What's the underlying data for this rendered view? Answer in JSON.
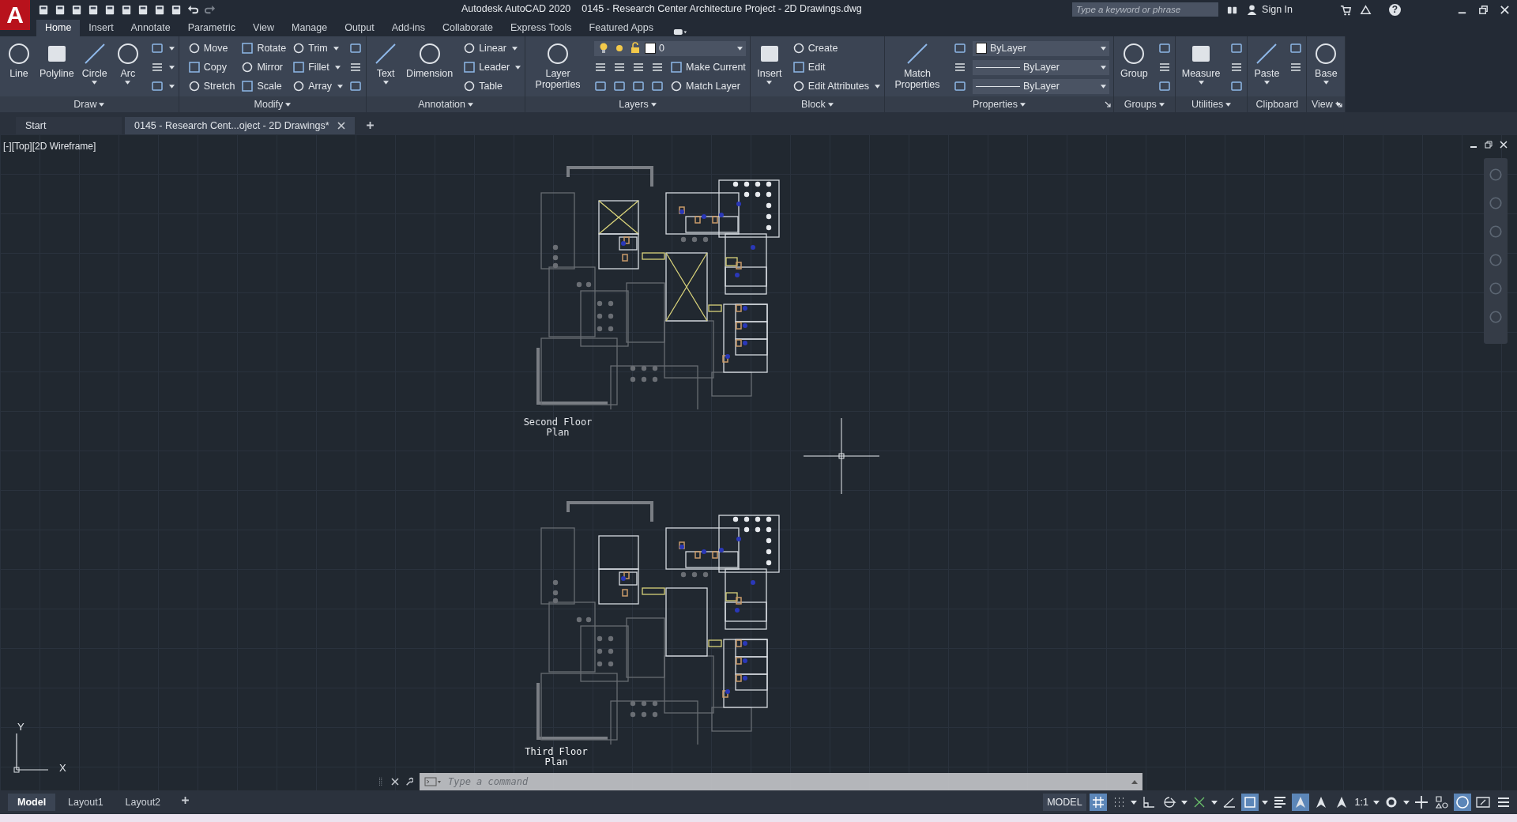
{
  "title_bar": {
    "logo": "A",
    "app": "Autodesk AutoCAD 2020",
    "document": "0145 - Research Center  Architecture Project - 2D Drawings.dwg",
    "search": {
      "placeholder": "Type a keyword or phrase"
    },
    "sign_in": "Sign In",
    "help": "?"
  },
  "ribbon_tabs": [
    {
      "label": "Home",
      "selected": true
    },
    {
      "label": "Insert",
      "selected": false
    },
    {
      "label": "Annotate",
      "selected": false
    },
    {
      "label": "Parametric",
      "selected": false
    },
    {
      "label": "View",
      "selected": false
    },
    {
      "label": "Manage",
      "selected": false
    },
    {
      "label": "Output",
      "selected": false
    },
    {
      "label": "Add-ins",
      "selected": false
    },
    {
      "label": "Collaborate",
      "selected": false
    },
    {
      "label": "Express Tools",
      "selected": false
    },
    {
      "label": "Featured Apps",
      "selected": false
    }
  ],
  "ribbon_panels": [
    {
      "title": "Draw",
      "title_dropdown": true,
      "launcher": false,
      "tools": [
        {
          "label": "Line",
          "dropdown": false
        },
        {
          "label": "Polyline",
          "dropdown": false
        },
        {
          "label": "Circle",
          "dropdown": true
        },
        {
          "label": "Arc",
          "dropdown": true
        }
      ],
      "rows": [
        [
          {
            "kind": "icon",
            "dropdown": true
          }
        ],
        [
          {
            "kind": "icon",
            "dropdown": true
          }
        ],
        [
          {
            "kind": "icon",
            "dropdown": true
          }
        ]
      ]
    },
    {
      "title": "Modify",
      "title_dropdown": true,
      "launcher": false,
      "rows": [
        [
          {
            "kind": "small",
            "label": "Move",
            "dropdown": false
          },
          {
            "kind": "small",
            "label": "Rotate",
            "dropdown": false
          },
          {
            "kind": "small",
            "label": "Trim",
            "dropdown": true
          },
          {
            "kind": "icon",
            "dropdown": false
          }
        ],
        [
          {
            "kind": "small",
            "label": "Copy",
            "dropdown": false
          },
          {
            "kind": "small",
            "label": "Mirror",
            "dropdown": false
          },
          {
            "kind": "small",
            "label": "Fillet",
            "dropdown": true
          },
          {
            "kind": "icon",
            "dropdown": false
          }
        ],
        [
          {
            "kind": "small",
            "label": "Stretch",
            "dropdown": false
          },
          {
            "kind": "small",
            "label": "Scale",
            "dropdown": false
          },
          {
            "kind": "small",
            "label": "Array",
            "dropdown": true
          },
          {
            "kind": "icon",
            "dropdown": false
          }
        ]
      ]
    },
    {
      "title": "Annotation",
      "title_dropdown": true,
      "launcher": false,
      "tools": [
        {
          "label": "Text",
          "dropdown": true
        },
        {
          "label": "Dimension",
          "dropdown": false
        }
      ],
      "rows": [
        [
          {
            "kind": "small",
            "label": "Linear",
            "dropdown": true
          }
        ],
        [
          {
            "kind": "small",
            "label": "Leader",
            "dropdown": true
          }
        ],
        [
          {
            "kind": "small",
            "label": "Table",
            "dropdown": false
          }
        ]
      ]
    },
    {
      "title": "Layers",
      "title_dropdown": true,
      "launcher": false,
      "tools": [
        {
          "label": "Layer Properties",
          "dropdown": false
        }
      ],
      "rows": [
        [
          {
            "kind": "layer-select",
            "value": "0"
          }
        ],
        [
          {
            "kind": "icon",
            "dropdown": false
          },
          {
            "kind": "icon",
            "dropdown": false
          },
          {
            "kind": "icon",
            "dropdown": false
          },
          {
            "kind": "icon",
            "dropdown": false
          },
          {
            "kind": "small",
            "label": "Make Current",
            "dropdown": false
          }
        ],
        [
          {
            "kind": "icon",
            "dropdown": false
          },
          {
            "kind": "icon",
            "dropdown": false
          },
          {
            "kind": "icon",
            "dropdown": false
          },
          {
            "kind": "icon",
            "dropdown": false
          },
          {
            "kind": "small",
            "label": "Match Layer",
            "dropdown": false
          }
        ]
      ]
    },
    {
      "title": "Block",
      "title_dropdown": true,
      "launcher": false,
      "tools": [
        {
          "label": "Insert",
          "dropdown": true
        }
      ],
      "rows": [
        [
          {
            "kind": "small",
            "label": "Create",
            "dropdown": false
          }
        ],
        [
          {
            "kind": "small",
            "label": "Edit",
            "dropdown": false
          }
        ],
        [
          {
            "kind": "small",
            "label": "Edit Attributes",
            "dropdown": true
          }
        ]
      ]
    },
    {
      "title": "Properties",
      "title_dropdown": true,
      "launcher": true,
      "tools": [
        {
          "label": "Match Properties",
          "dropdown": false
        }
      ],
      "rows": [
        [
          {
            "kind": "icon",
            "dropdown": false
          },
          {
            "kind": "color-select",
            "value": "ByLayer"
          }
        ],
        [
          {
            "kind": "icon",
            "dropdown": false
          },
          {
            "kind": "line-select",
            "value": "ByLayer"
          }
        ],
        [
          {
            "kind": "icon",
            "dropdown": false
          },
          {
            "kind": "line-select",
            "value": "ByLayer"
          }
        ]
      ]
    },
    {
      "title": "Groups",
      "title_dropdown": true,
      "launcher": false,
      "tools": [
        {
          "label": "Group",
          "dropdown": false
        }
      ],
      "rows": [
        [
          {
            "kind": "icon",
            "dropdown": false
          }
        ],
        [
          {
            "kind": "icon",
            "dropdown": false
          }
        ],
        [
          {
            "kind": "icon",
            "dropdown": false
          }
        ]
      ]
    },
    {
      "title": "Utilities",
      "title_dropdown": true,
      "launcher": false,
      "tools": [
        {
          "label": "Measure",
          "dropdown": true
        }
      ],
      "rows": [
        [
          {
            "kind": "icon",
            "dropdown": false
          }
        ],
        [
          {
            "kind": "icon",
            "dropdown": false
          }
        ],
        [
          {
            "kind": "icon",
            "dropdown": false
          }
        ]
      ]
    },
    {
      "title": "Clipboard",
      "title_dropdown": false,
      "launcher": false,
      "tools": [
        {
          "label": "Paste",
          "dropdown": true
        }
      ],
      "rows": [
        [
          {
            "kind": "icon",
            "dropdown": false
          }
        ],
        [
          {
            "kind": "icon",
            "dropdown": false
          }
        ]
      ]
    },
    {
      "title": "View",
      "title_dropdown": true,
      "launcher": true,
      "tools": [
        {
          "label": "Base",
          "dropdown": true
        }
      ]
    }
  ],
  "file_tabs": [
    {
      "label": "Start",
      "selected": false,
      "closable": false
    },
    {
      "label": "0145 - Research Cent...oject - 2D Drawings*",
      "selected": true,
      "closable": true
    }
  ],
  "viewport": {
    "label": "[-][Top][2D Wireframe]",
    "plans": [
      {
        "caption": "Second Floor Plan"
      },
      {
        "caption": "Third Floor Plan"
      }
    ],
    "ucs": {
      "y": "Y",
      "x": "X"
    }
  },
  "command_line": {
    "placeholder": "Type a command"
  },
  "layout_tabs": [
    {
      "label": "Model",
      "selected": true
    },
    {
      "label": "Layout1",
      "selected": false
    },
    {
      "label": "Layout2",
      "selected": false
    }
  ],
  "status_bar": [
    {
      "kind": "label",
      "label": "MODEL"
    },
    {
      "kind": "grid",
      "on": true
    },
    {
      "kind": "snap",
      "on": false
    },
    {
      "kind": "caret"
    },
    {
      "kind": "ortho",
      "on": false
    },
    {
      "kind": "polar",
      "on": false
    },
    {
      "kind": "caret"
    },
    {
      "kind": "isodraft",
      "on": false
    },
    {
      "kind": "caret"
    },
    {
      "kind": "angle",
      "on": false
    },
    {
      "kind": "osnap",
      "on": true
    },
    {
      "kind": "caret"
    },
    {
      "kind": "lineweight",
      "on": false
    },
    {
      "kind": "annotation",
      "on": true
    },
    {
      "kind": "autoscale",
      "on": false
    },
    {
      "kind": "annoscale",
      "on": false
    },
    {
      "kind": "scale",
      "label": "1:1"
    },
    {
      "kind": "caret"
    },
    {
      "kind": "gear",
      "on": false
    },
    {
      "kind": "caret"
    },
    {
      "kind": "plus",
      "on": false
    },
    {
      "kind": "isolate",
      "on": false
    },
    {
      "kind": "accel",
      "on": true
    },
    {
      "kind": "fullscreen",
      "on": false
    },
    {
      "kind": "menu",
      "on": false
    }
  ]
}
